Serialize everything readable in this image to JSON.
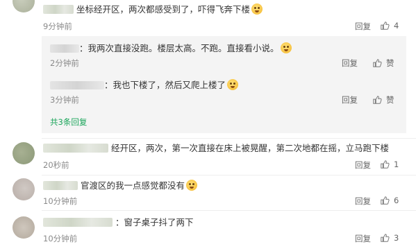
{
  "comments": [
    {
      "text": "坐标经开区，两次都感受到了，吓得飞奔下楼",
      "time": "9分钟前",
      "reply_label": "回复",
      "likes": "4"
    },
    {
      "text": "经开区，两次，第一次直接在床上被晃醒，第二次地都在摇，立马跑下楼",
      "time": "20秒前",
      "reply_label": "回复",
      "likes": "1"
    },
    {
      "text": "官渡区的我一点感觉都没有",
      "time": "10分钟前",
      "reply_label": "回复",
      "likes": "6"
    },
    {
      "text": "窗子桌子抖了两下",
      "time": "10分钟前",
      "reply_label": "回复",
      "likes": "3"
    }
  ],
  "sub_replies": [
    {
      "text": "我两次直接没跑。楼层太高。不跑。直接看小说。",
      "time": "2分钟前",
      "reply_label": "回复",
      "like_label": "赞"
    },
    {
      "text": "我也下楼了，然后又爬上楼了",
      "time": "3分钟前",
      "reply_label": "回复",
      "like_label": "赞"
    }
  ],
  "expand_label": "共3条回复",
  "icons": {
    "like": "thumbs-up-icon",
    "emoji_cry": "crying-face-icon",
    "emoji_smile": "smiling-face-icon"
  },
  "colors": {
    "accent_green": "#1aa55a",
    "sub_box_bg": "#f4f4f4",
    "muted_text": "#8a8a8a"
  }
}
